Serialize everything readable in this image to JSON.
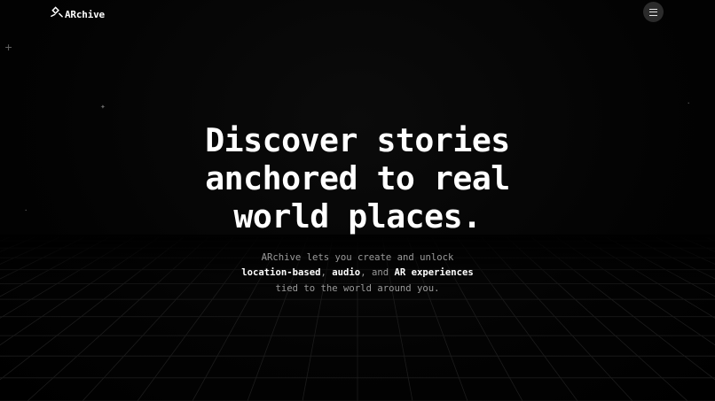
{
  "header": {
    "logo_text": "ARchive",
    "menu_icon": "hamburger-menu-icon"
  },
  "hero": {
    "title_lines": [
      "Discover stories",
      "anchored to real",
      "world places."
    ],
    "subtitle": {
      "line1": "ARchive lets you create and unlock",
      "line2_bold1": "location-based",
      "line2_sep1": ", ",
      "line2_bold2": "audio",
      "line2_sep2": ", and ",
      "line2_bold3": "AR experiences",
      "line3": "tied to the world around you."
    }
  },
  "colors": {
    "background": "#000000",
    "text_primary": "#ffffff",
    "text_muted": "#9a9a9a",
    "menu_button_bg": "#2b2b2b",
    "grid_line": "#1a1a1a"
  }
}
